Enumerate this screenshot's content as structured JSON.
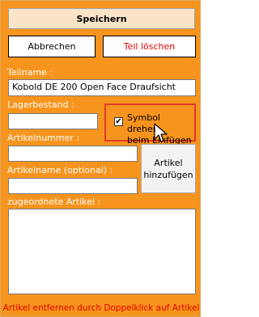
{
  "buttons": {
    "save": "Speichern",
    "cancel": "Abbrechen",
    "delete": "Teil löschen",
    "add_article_line1": "Artikel",
    "add_article_line2": "hinzufügen"
  },
  "fields": {
    "part_name_label": "Teilname :",
    "part_name_value": "Kobold DE 200 Open Face Draufsicht",
    "stock_label": "Lagerbestand :",
    "stock_value": "",
    "article_number_label": "Artikelnummer :",
    "article_number_value": "",
    "article_name_label": "Artikelname (optional) :",
    "article_name_value": "",
    "assigned_articles_label": "zugeordnete Artikel :"
  },
  "checkbox": {
    "label_line1": "Symbol drehen",
    "label_line2": "beim Einfügen",
    "checked": true,
    "check_glyph": "✔"
  },
  "assigned_articles": [],
  "footer": {
    "note": "Artikel entfernen durch Doppelklick auf Artikel"
  },
  "colors": {
    "panel_bg": "#f7941d",
    "label_text": "#ffffff",
    "delete_text": "#e00000",
    "highlight_border": "#e03a2a"
  }
}
